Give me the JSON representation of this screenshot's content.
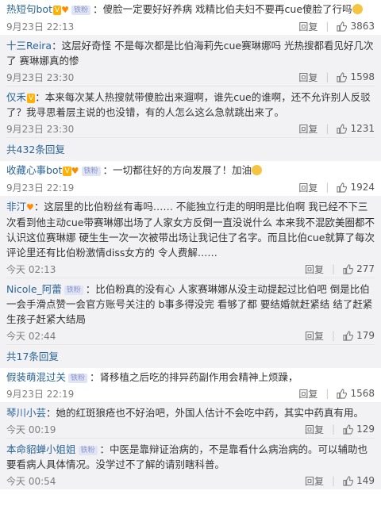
{
  "comments": [
    {
      "name": "热短句bot",
      "tag": "铁粉",
      "text": "傻脸一定要好好养病 戏精比伯夫妇不要再cue傻脸了行吗",
      "time": "9月23日 22:13",
      "reply": "回复",
      "likes": "3863",
      "replies": [
        {
          "name": "十三Reira",
          "text": "这层好奇怪 不是每次都是比伯海莉先cue赛琳娜吗 光热搜都看见好几次了 赛琳娜真的惨",
          "time": "9月23日 23:30",
          "reply": "回复",
          "likes": "1598"
        },
        {
          "name": "仅禾",
          "text": "本来每次某人热搜就带傻脸出来遛啊，谁先cue的谁啊，还不允许别人反驳了？我寻思着层主说的也没错，有的人怎么这么急就跳出来了。",
          "time": "9月23日 23:30",
          "reply": "回复",
          "likes": "1231"
        }
      ],
      "more": "共432条回复"
    },
    {
      "name": "收藏心事bot",
      "tag": "铁粉",
      "text": "一切都往好的方向发展了！加油",
      "time": "9月23日 22:19",
      "reply": "回复",
      "likes": "1924",
      "replies": [
        {
          "name": "非汀",
          "text": "这层里的比伯粉丝有毒吗…… 不能独立行走的明明是比伯啊 我已经不下三次看到他主动cue带赛琳娜出场了人家女方反倒一直没说什么 本来我不混欧美圈都不认识这位赛琳娜 硬生生一次一次被带出场让我记住了名字。而且比伯cue就算了每次评论里还有比伯粉激情diss女方的 令人费解……",
          "time": "今天 02:13",
          "reply": "回复",
          "likes": "277"
        },
        {
          "name": "Nicole_阿蕾",
          "tag": "铁粉",
          "text": "比伯粉真的没有心 人家赛琳娜从没主动提起过比伯吧 倒是比伯一会手滑点赞一会官方账号关注的 b事多得没完 看够了都 要结婚就赶紧结 结了赶紧生孩子赶紧大结局",
          "time": "今天 02:44",
          "reply": "回复",
          "likes": "179"
        }
      ],
      "more": "共17条回复"
    },
    {
      "name": "假装萌混过关",
      "tag": "铁粉",
      "text": "肾移植之后吃的排异药副作用会精神上烦躁，",
      "time": "9月23日 22:19",
      "reply": "回复",
      "likes": "1568",
      "replies": [
        {
          "name": "琴川小芸",
          "text": "她的红斑狼疮也不好治吧，外国人估计不会吃中药，其实中药真有用。",
          "time": "今天 00:19",
          "reply": "回复",
          "likes": "129"
        },
        {
          "name": "本命貂蝉小姐姐",
          "tag": "铁粉",
          "text": "中医是靠辩证治病的，不是靠看什么病治病的。可以辅助也要看病人具体情况。没学过不了解的请别瞎科普。",
          "time": "今天 00:54",
          "reply": "回复",
          "likes": "149"
        }
      ]
    }
  ]
}
